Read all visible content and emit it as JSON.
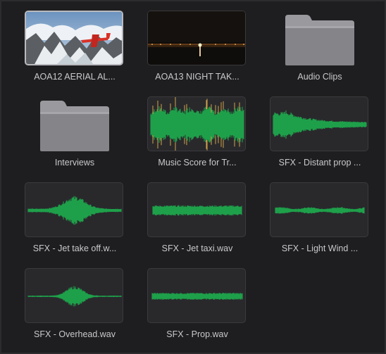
{
  "clips": [
    {
      "type": "video",
      "label": "AOA12 AERIAL AL...",
      "thumb": "aerial-plane-mountains",
      "selected": true
    },
    {
      "type": "video",
      "label": "AOA13 NIGHT TAK...",
      "thumb": "night-runway",
      "selected": false
    },
    {
      "type": "folder",
      "label": "Audio Clips"
    },
    {
      "type": "folder",
      "label": "Interviews"
    },
    {
      "type": "audio",
      "label": "Music Score for Tr...",
      "waveform": "music"
    },
    {
      "type": "audio",
      "label": "SFX - Distant prop ...",
      "waveform": "distant"
    },
    {
      "type": "audio",
      "label": "SFX - Jet take off.w...",
      "waveform": "takeoff"
    },
    {
      "type": "audio",
      "label": "SFX - Jet taxi.wav",
      "waveform": "taxi"
    },
    {
      "type": "audio",
      "label": "SFX - Light Wind ...",
      "waveform": "wind"
    },
    {
      "type": "audio",
      "label": "SFX - Overhead.wav",
      "waveform": "overhead"
    },
    {
      "type": "audio",
      "label": "SFX - Prop.wav",
      "waveform": "prop"
    }
  ],
  "colors": {
    "waveform": "#1fa04a",
    "waveform_peak": "#d1a34a",
    "folder": "#8a8a8e",
    "folder_tab": "#9b9b9f"
  }
}
